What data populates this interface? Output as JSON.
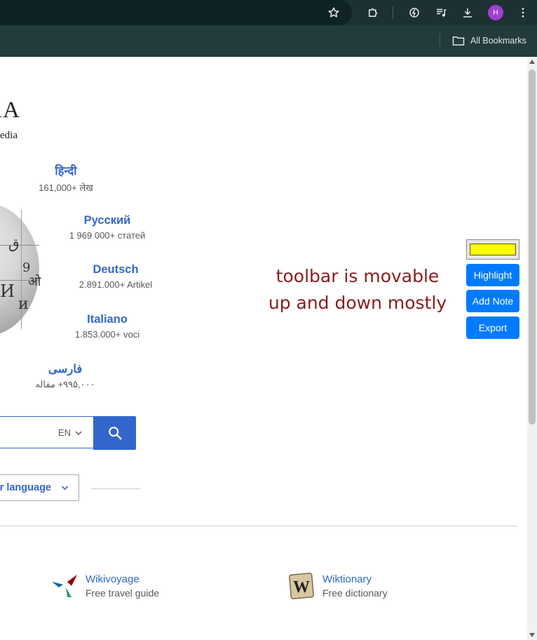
{
  "browser": {
    "avatar_initial": "H",
    "bookmarks_label": "All Bookmarks"
  },
  "header": {
    "wordmark_fragment": "ıA",
    "tagline_fragment": "edia"
  },
  "languages": [
    {
      "name": "हिन्दी",
      "count": "161,000+ लेख"
    },
    {
      "name": "Русский",
      "count": "1 969 000+ статей"
    },
    {
      "name": "Deutsch",
      "count": "2.891.000+ Artikel"
    },
    {
      "name": "Italiano",
      "count": "1.853.000+ voci"
    },
    {
      "name": "فارسی",
      "count": "۹۹۵,۰۰۰+ مقاله"
    }
  ],
  "search": {
    "lang_code": "EN"
  },
  "language_button": {
    "label_fragment": "r language"
  },
  "annotation": {
    "line1": "toolbar is movable",
    "line2": "up and down mostly"
  },
  "toolbar": {
    "color": "#ffff00",
    "highlight_label": "Highlight",
    "add_note_label": "Add Note",
    "export_label": "Export"
  },
  "projects": [
    {
      "name": "Wikivoyage",
      "desc": "Free travel guide"
    },
    {
      "name": "Wiktionary",
      "desc": "Free dictionary"
    }
  ],
  "colors": {
    "link_blue": "#3366cc",
    "toolbar_blue": "#007bff",
    "chrome_dark": "#1d3132"
  }
}
